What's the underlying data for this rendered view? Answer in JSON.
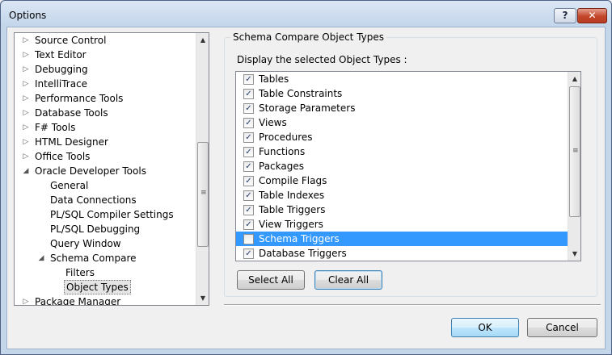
{
  "window": {
    "title": "Options",
    "help_label": "?",
    "close_label": "✕"
  },
  "tree": {
    "items": [
      {
        "label": "Source Control",
        "level": 0,
        "expander": "collapsed"
      },
      {
        "label": "Text Editor",
        "level": 0,
        "expander": "collapsed"
      },
      {
        "label": "Debugging",
        "level": 0,
        "expander": "collapsed"
      },
      {
        "label": "IntelliTrace",
        "level": 0,
        "expander": "collapsed"
      },
      {
        "label": "Performance Tools",
        "level": 0,
        "expander": "collapsed"
      },
      {
        "label": "Database Tools",
        "level": 0,
        "expander": "collapsed"
      },
      {
        "label": "F# Tools",
        "level": 0,
        "expander": "collapsed"
      },
      {
        "label": "HTML Designer",
        "level": 0,
        "expander": "collapsed"
      },
      {
        "label": "Office Tools",
        "level": 0,
        "expander": "collapsed"
      },
      {
        "label": "Oracle Developer Tools",
        "level": 0,
        "expander": "expanded"
      },
      {
        "label": "General",
        "level": 1,
        "expander": "none"
      },
      {
        "label": "Data Connections",
        "level": 1,
        "expander": "none"
      },
      {
        "label": "PL/SQL Compiler Settings",
        "level": 1,
        "expander": "none"
      },
      {
        "label": "PL/SQL Debugging",
        "level": 1,
        "expander": "none"
      },
      {
        "label": "Query Window",
        "level": 1,
        "expander": "none"
      },
      {
        "label": "Schema Compare",
        "level": 1,
        "expander": "expanded"
      },
      {
        "label": "Filters",
        "level": 2,
        "expander": "none"
      },
      {
        "label": "Object Types",
        "level": 2,
        "expander": "none",
        "selected": true
      },
      {
        "label": "Package Manager",
        "level": 0,
        "expander": "collapsed"
      }
    ],
    "scroll_position": 0.68
  },
  "panel": {
    "group_title": "Schema Compare Object Types",
    "display_label": "Display the selected Object Types :",
    "object_types": [
      {
        "label": "Tables",
        "checked": true
      },
      {
        "label": "Table Constraints",
        "checked": true
      },
      {
        "label": "Storage Parameters",
        "checked": true
      },
      {
        "label": "Views",
        "checked": true
      },
      {
        "label": "Procedures",
        "checked": true
      },
      {
        "label": "Functions",
        "checked": true
      },
      {
        "label": "Packages",
        "checked": true
      },
      {
        "label": "Compile Flags",
        "checked": true
      },
      {
        "label": "Table Indexes",
        "checked": true
      },
      {
        "label": "Table Triggers",
        "checked": true
      },
      {
        "label": "View Triggers",
        "checked": true
      },
      {
        "label": "Schema Triggers",
        "checked": false,
        "selected": true
      },
      {
        "label": "Database Triggers",
        "checked": true
      }
    ],
    "select_all_label": "Select All",
    "clear_all_label": "Clear All"
  },
  "footer": {
    "ok_label": "OK",
    "cancel_label": "Cancel"
  },
  "colors": {
    "selection": "#3399ff",
    "titlebar": "#c4d6ea"
  }
}
